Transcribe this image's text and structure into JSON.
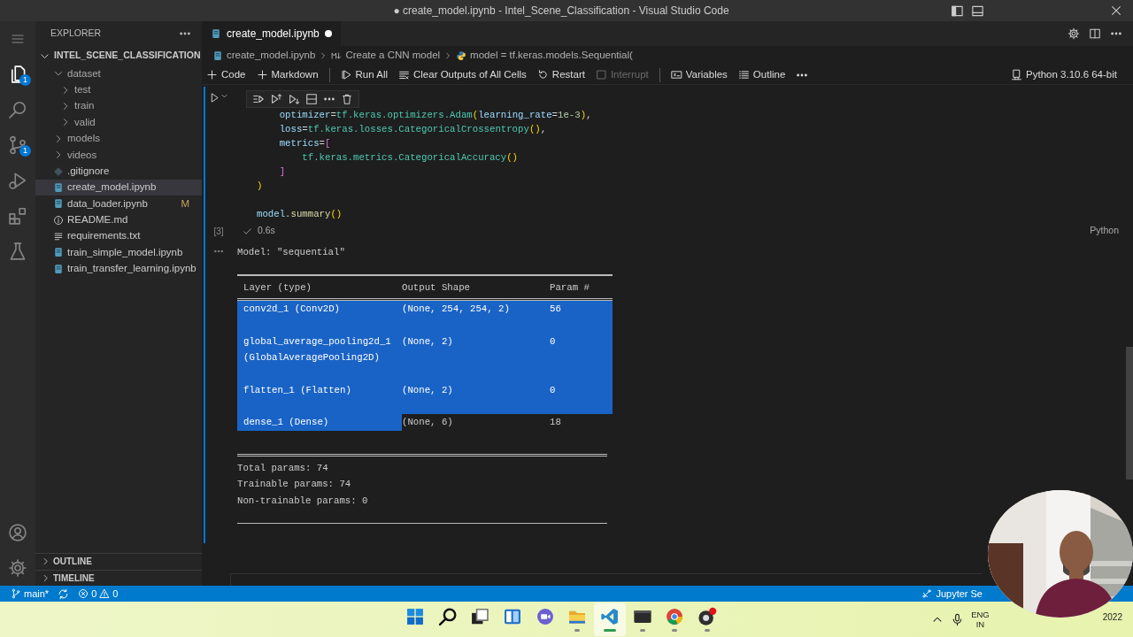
{
  "window": {
    "title": "● create_model.ipynb - Intel_Scene_Classification - Visual Studio Code"
  },
  "activity_bar": {
    "items": [
      {
        "kind": "explorer",
        "selected": true,
        "badge": "1"
      },
      {
        "kind": "search",
        "selected": false
      },
      {
        "kind": "source-control",
        "selected": false,
        "badge": "1"
      },
      {
        "kind": "run",
        "selected": false
      },
      {
        "kind": "extensions",
        "selected": false
      },
      {
        "kind": "testing",
        "selected": false
      }
    ],
    "bottom": [
      {
        "kind": "account"
      },
      {
        "kind": "settings"
      }
    ]
  },
  "sidebar": {
    "title": "EXPLORER",
    "folder": {
      "name": "INTEL_SCENE_CLASSIFICATION",
      "expanded": true
    },
    "tree": [
      {
        "name": "dataset",
        "kind": "folder",
        "expanded": true,
        "selected": false,
        "children": [
          {
            "name": "test",
            "kind": "folder",
            "expanded": false,
            "selected": false
          },
          {
            "name": "train",
            "kind": "folder",
            "expanded": false,
            "selected": false
          },
          {
            "name": "valid",
            "kind": "folder",
            "expanded": false,
            "selected": false
          }
        ]
      },
      {
        "name": "models",
        "kind": "folder",
        "expanded": false,
        "selected": false
      },
      {
        "name": "videos",
        "kind": "folder",
        "expanded": false,
        "selected": false
      },
      {
        "name": ".gitignore",
        "kind": "git",
        "selected": false
      },
      {
        "name": "create_model.ipynb",
        "kind": "notebook",
        "selected": true
      },
      {
        "name": "data_loader.ipynb",
        "kind": "notebook",
        "selected": false,
        "decoration": "M"
      },
      {
        "name": "README.md",
        "kind": "info",
        "selected": false
      },
      {
        "name": "requirements.txt",
        "kind": "text",
        "selected": false
      },
      {
        "name": "train_simple_model.ipynb",
        "kind": "notebook",
        "selected": false
      },
      {
        "name": "train_transfer_learning.ipynb",
        "kind": "notebook",
        "selected": false
      }
    ],
    "panels": [
      {
        "title": "OUTLINE",
        "expanded": false
      },
      {
        "title": "TIMELINE",
        "expanded": false
      }
    ]
  },
  "editor": {
    "tabs": [
      {
        "label": "create_model.ipynb",
        "selected": true,
        "modified": true
      }
    ],
    "breadcrumbs": [
      {
        "kind": "notebook",
        "text": "create_model.ipynb"
      },
      {
        "kind": "markdown",
        "text": "Create a CNN model"
      },
      {
        "kind": "python",
        "text": "model = tf.keras.models.Sequential("
      }
    ],
    "toolbar": [
      {
        "kind": "add",
        "label": "Code",
        "disabled": false
      },
      {
        "kind": "add",
        "label": "Markdown",
        "disabled": false
      },
      {
        "kind": "separator"
      },
      {
        "kind": "run-all",
        "label": "Run All",
        "disabled": false
      },
      {
        "kind": "clear",
        "label": "Clear Outputs of All Cells",
        "disabled": false
      },
      {
        "kind": "restart",
        "label": "Restart",
        "disabled": false
      },
      {
        "kind": "interrupt",
        "label": "Interrupt",
        "disabled": true
      },
      {
        "kind": "separator"
      },
      {
        "kind": "variables",
        "label": "Variables",
        "disabled": false
      },
      {
        "kind": "outline",
        "label": "Outline",
        "disabled": false
      },
      {
        "kind": "more",
        "disabled": false
      }
    ],
    "kernel": "Python 3.10.6 64-bit",
    "cell": {
      "code": [
        {
          "tokens": [
            {
              "kind": "var",
              "text": "    optimizer"
            },
            {
              "kind": "op",
              "text": "="
            },
            {
              "kind": "cls",
              "text": "tf.keras.optimizers.Adam"
            },
            {
              "kind": "br1",
              "text": "("
            },
            {
              "kind": "var",
              "text": "learning_rate"
            },
            {
              "kind": "op",
              "text": "="
            },
            {
              "kind": "num",
              "text": "1e-3"
            },
            {
              "kind": "br1",
              "text": ")"
            },
            {
              "kind": "op",
              "text": ","
            }
          ]
        },
        {
          "tokens": [
            {
              "kind": "var",
              "text": "    loss"
            },
            {
              "kind": "op",
              "text": "="
            },
            {
              "kind": "cls",
              "text": "tf.keras.losses.CategoricalCrossentropy"
            },
            {
              "kind": "br1",
              "text": "()"
            },
            {
              "kind": "op",
              "text": ","
            }
          ]
        },
        {
          "tokens": [
            {
              "kind": "var",
              "text": "    metrics"
            },
            {
              "kind": "op",
              "text": "="
            },
            {
              "kind": "br2",
              "text": "["
            }
          ]
        },
        {
          "tokens": [
            {
              "kind": "cls",
              "text": "        tf.keras.metrics.CategoricalAccuracy"
            },
            {
              "kind": "br1",
              "text": "()"
            }
          ]
        },
        {
          "tokens": [
            {
              "kind": "br2",
              "text": "    ]"
            }
          ]
        },
        {
          "tokens": [
            {
              "kind": "br1",
              "text": ")"
            }
          ]
        },
        {
          "gap_before": true,
          "tokens": [
            {
              "kind": "var",
              "text": "model"
            },
            {
              "kind": "op",
              "text": "."
            },
            {
              "kind": "fn",
              "text": "summary"
            },
            {
              "kind": "br1",
              "text": "()"
            }
          ]
        }
      ],
      "execution_count": "[3]",
      "succeeded": true,
      "duration": "0.6s",
      "language": "Python"
    },
    "output": {
      "title": "Model: \"sequential\"",
      "columns": [
        "Layer (type)",
        "Output Shape",
        "Param #"
      ],
      "rows": [
        {
          "cells": [
            {
              "text": "conv2d_1 (Conv2D)",
              "selected": true
            },
            {
              "text": "(None, 254, 254, 2)",
              "selected": true
            },
            {
              "text": "56",
              "selected": true
            }
          ]
        },
        {
          "cells": [
            {
              "text": "global_average_pooling2d_1 (GlobalAveragePooling2D)",
              "selected": true
            },
            {
              "text": "(None, 2)",
              "selected": true
            },
            {
              "text": "0",
              "selected": true
            }
          ]
        },
        {
          "cells": [
            {
              "text": "flatten_1 (Flatten)",
              "selected": true
            },
            {
              "text": "(None, 2)",
              "selected": true
            },
            {
              "text": "0",
              "selected": true
            }
          ]
        },
        {
          "cells": [
            {
              "text": "dense_1 (Dense)",
              "selected": true
            },
            {
              "text": "(None, 6)",
              "selected": false
            },
            {
              "text": "18",
              "selected": false
            }
          ]
        }
      ],
      "totals": [
        "Total params: 74",
        "Trainable params: 74",
        "Non-trainable params: 0"
      ]
    }
  },
  "status_bar": {
    "branch": "main*",
    "errors": "0",
    "warnings": "0",
    "right": "Jupyter Se"
  },
  "taskbar": {
    "apps": [
      {
        "kind": "start",
        "selected": false
      },
      {
        "kind": "search",
        "selected": false
      },
      {
        "kind": "task-view",
        "selected": false
      },
      {
        "kind": "widgets",
        "selected": false
      },
      {
        "kind": "chat",
        "selected": false
      },
      {
        "kind": "file-explorer",
        "running": true,
        "selected": false
      },
      {
        "kind": "code-editor",
        "running": true,
        "selected": true
      },
      {
        "kind": "terminal",
        "running": true,
        "selected": false
      },
      {
        "kind": "browser",
        "running": true,
        "selected": false
      },
      {
        "kind": "recorder",
        "running": true,
        "selected": false
      }
    ],
    "tray": {
      "language": "ENG",
      "region": "IN",
      "date": "2022"
    }
  }
}
